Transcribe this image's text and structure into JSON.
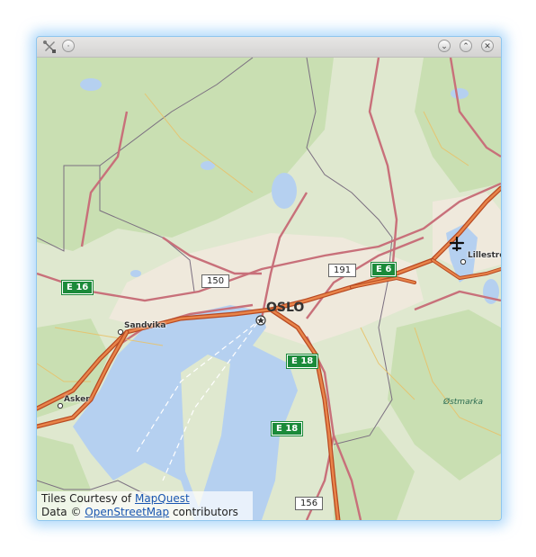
{
  "window": {
    "buttons": [
      "menu",
      "minimize",
      "maximize",
      "close"
    ]
  },
  "map": {
    "labels": {
      "oslo": "OSLO",
      "sandvika": "Sandvika",
      "asker": "Asker",
      "lillestrom": "Lilleströ",
      "ostmarka": "Østmarka"
    },
    "shields": {
      "e16": "E 16",
      "e6": "E 6",
      "e18_top": "E 18",
      "e18_bottom": "E 18",
      "r150": "150",
      "r191": "191",
      "r156": "156"
    },
    "colors": {
      "water": "#b5d0f0",
      "forest": "#c8dfb0",
      "urban": "#efe9dc",
      "motorway": "#d46a3c",
      "primary": "#c8707a",
      "border": "#7b6f80"
    }
  },
  "attribution": {
    "tiles_prefix": "Tiles Courtesy of ",
    "tiles_link": "MapQuest",
    "data_prefix": "Data © ",
    "data_link": "OpenStreetMap",
    "data_suffix": " contributors"
  }
}
